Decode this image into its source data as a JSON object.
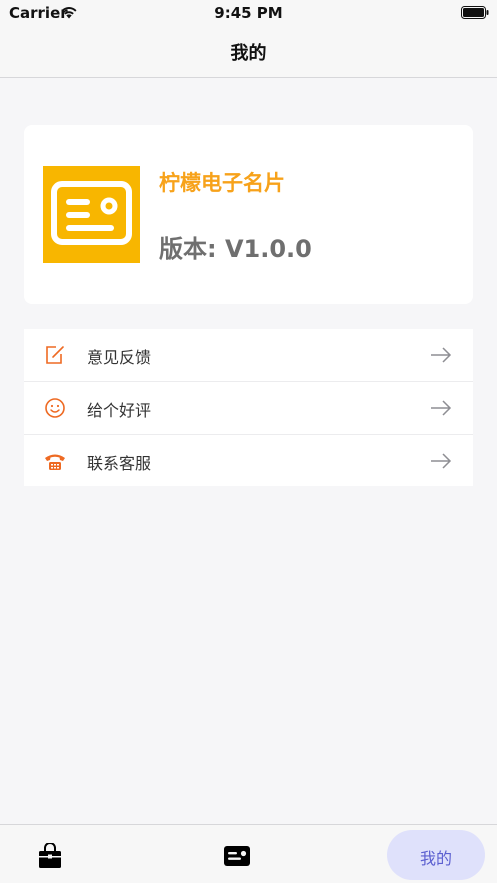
{
  "status_bar": {
    "carrier": "Carrier",
    "time": "9:45 PM",
    "wifi_icon": "wifi-icon",
    "battery_icon": "battery-icon"
  },
  "nav": {
    "title": "我的"
  },
  "app_info": {
    "name": "柠檬电子名片",
    "version": "版本: V1.0.0",
    "logo_icon": "business-card-icon",
    "logo_color": "#F8B600",
    "name_color": "#F7A21A"
  },
  "menu": {
    "items": [
      {
        "label": "意见反馈",
        "icon": "edit-icon"
      },
      {
        "label": "给个好评",
        "icon": "smile-icon"
      },
      {
        "label": "联系客服",
        "icon": "telephone-icon"
      }
    ],
    "icon_color": "#EE6A23",
    "arrow_icon": "arrow-right-icon"
  },
  "tab_bar": {
    "items": [
      {
        "icon": "shopping-bag-icon"
      },
      {
        "icon": "business-card-icon"
      },
      {
        "label": "我的",
        "selected": true
      }
    ],
    "active_color": "#5B5FD0"
  }
}
